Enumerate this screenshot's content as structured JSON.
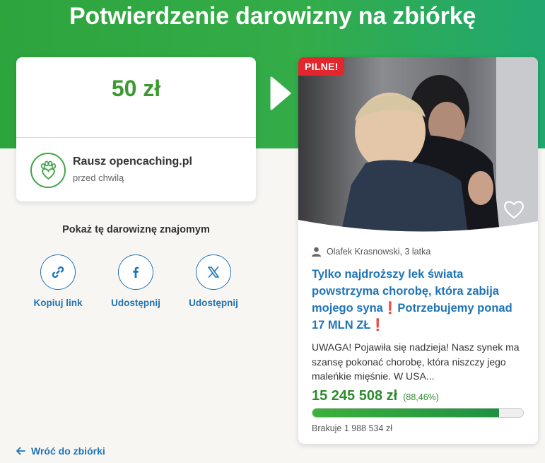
{
  "header": {
    "title": "Potwierdzenie darowizny na zbiórkę"
  },
  "donation": {
    "amount": "50 zł",
    "donor_name": "Rausz opencaching.pl",
    "time": "przed chwilą"
  },
  "share": {
    "heading": "Pokaż tę darowiznę znajomym",
    "buttons": [
      {
        "label": "Kopiuj link",
        "icon": "link-icon"
      },
      {
        "label": "Udostępnij",
        "icon": "facebook-icon"
      },
      {
        "label": "Udostępnij",
        "icon": "x-icon"
      }
    ]
  },
  "back_link": "Wróć do zbiórki",
  "campaign": {
    "badge": "PILNE!",
    "author": "Olafek Krasnowski, 3 latka",
    "title": "Tylko najdroższy lek świata powstrzyma chorobę, która zabija mojego syna❗Potrzebujemy ponad 17 MLN ZŁ❗",
    "description": "UWAGA! Pojawiła się nadzieja! Nasz synek ma szansę pokonać chorobę, która niszczy jego maleńkie mięśnie. W USA...",
    "raised": "15 245 508 zł",
    "percent": "(88,46%)",
    "progress": 0.8846,
    "missing": "Brakuje 1 988 534 zł"
  },
  "colors": {
    "brand_green": "#2ea43d",
    "link_blue": "#1f74b6",
    "amount_green": "#3d9a2e",
    "urgent_red": "#e3262e"
  }
}
